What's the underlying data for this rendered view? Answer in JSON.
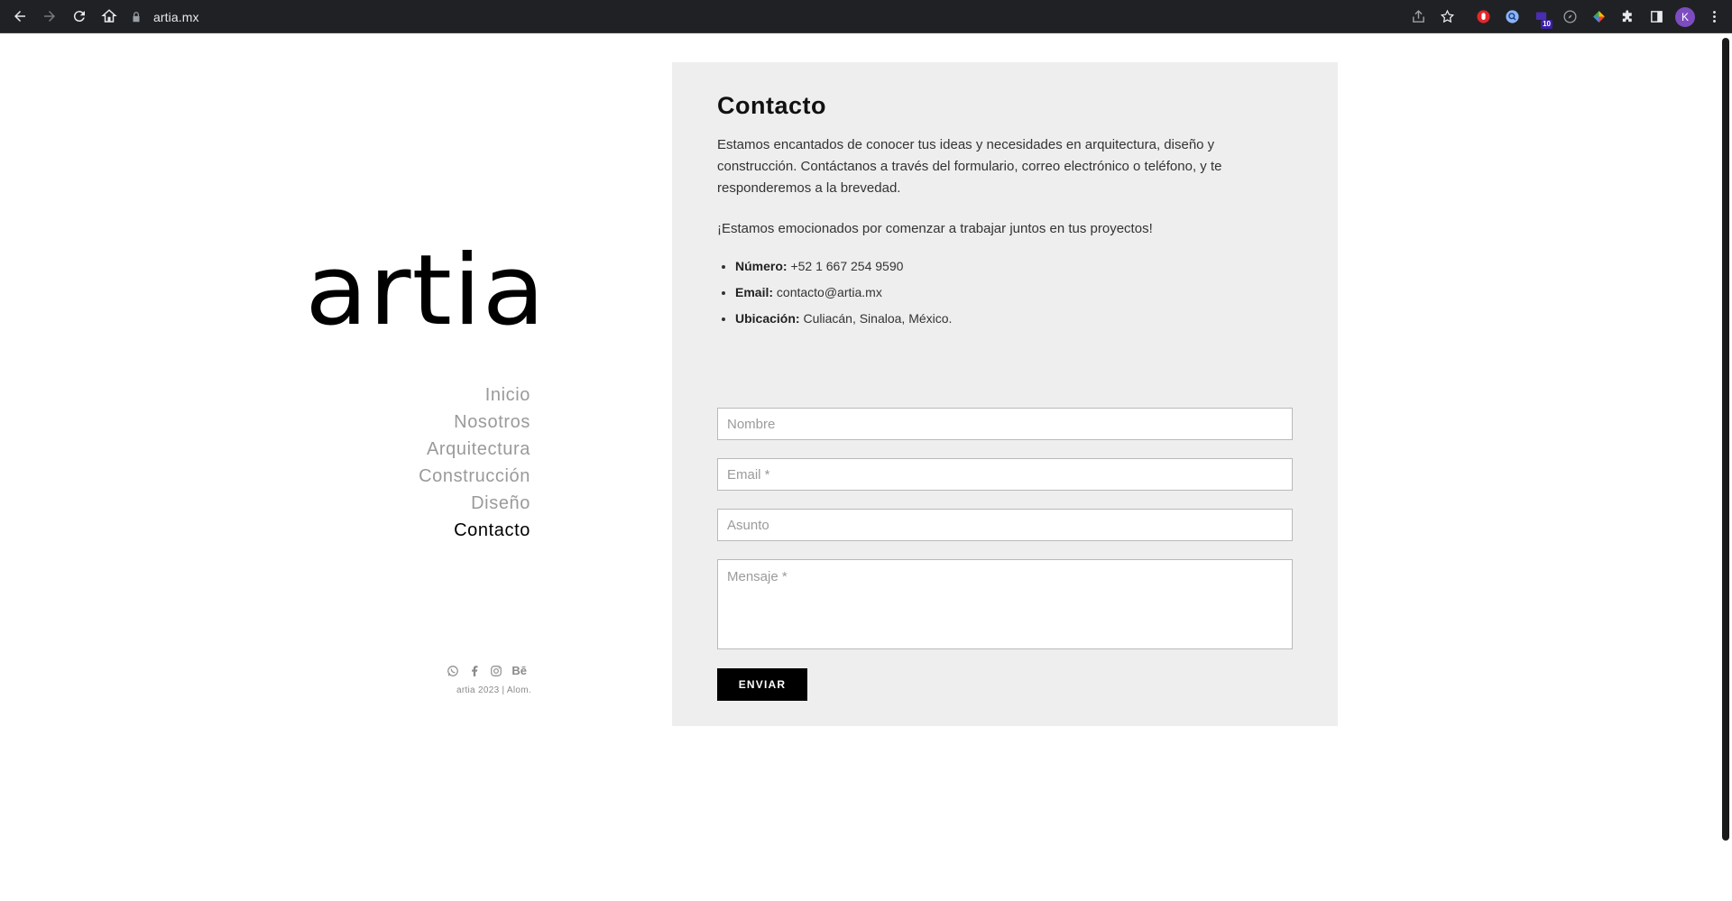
{
  "browser": {
    "url": "artia.mx",
    "profile_initial": "K",
    "extension_badge": "10"
  },
  "site": {
    "logo": "artia",
    "menu": [
      {
        "label": "Inicio"
      },
      {
        "label": "Nosotros"
      },
      {
        "label": "Arquitectura"
      },
      {
        "label": "Construcción"
      },
      {
        "label": "Diseño"
      },
      {
        "label": "Contacto",
        "active": true
      }
    ],
    "social": {
      "behance": "Bē"
    },
    "copyright": "artia 2023 | Alom."
  },
  "contact": {
    "title": "Contacto",
    "intro": "Estamos encantados de conocer tus ideas y necesidades en arquitectura, diseño y construcción. Contáctanos a través del formulario, correo electrónico o teléfono, y te responderemos a la brevedad.",
    "intro2": "¡Estamos emocionados por comenzar a trabajar juntos en tus proyectos!",
    "items": [
      {
        "label": "Número:",
        "value": "+52 1 667 254 9590"
      },
      {
        "label": "Email:",
        "value": "contacto@artia.mx"
      },
      {
        "label": "Ubicación:",
        "value": "Culiacán, Sinaloa, México."
      }
    ],
    "form": {
      "name_placeholder": "Nombre",
      "email_placeholder": "Email *",
      "subject_placeholder": "Asunto",
      "message_placeholder": "Mensaje *",
      "submit_label": "ENVIAR"
    }
  }
}
